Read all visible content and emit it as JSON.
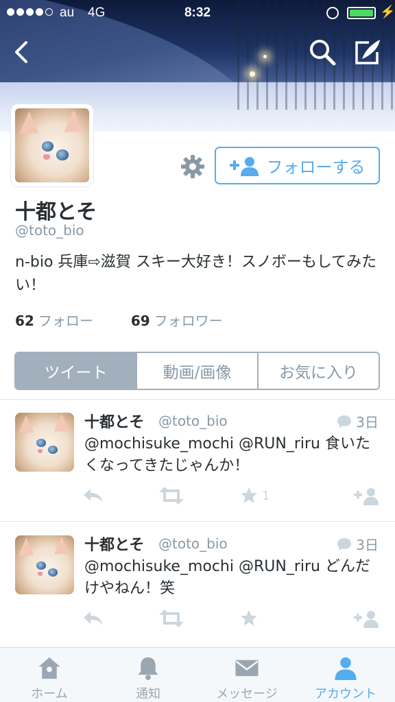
{
  "status_bar": {
    "carrier": "au",
    "network": "4G",
    "time": "8:32"
  },
  "profile": {
    "display_name": "十都とそ",
    "handle": "@toto_bio",
    "bio": "n-bio 兵庫⇨滋賀 スキー大好き！スノボーもしてみたい！",
    "following_count": "62",
    "following_label": "フォロー",
    "followers_count": "69",
    "followers_label": "フォロワー",
    "follow_button_label": "フォローする"
  },
  "segments": [
    {
      "label": "ツイート",
      "active": true
    },
    {
      "label": "動画/画像",
      "active": false
    },
    {
      "label": "お気に入り",
      "active": false
    }
  ],
  "tweets": [
    {
      "name": "十都とそ",
      "handle": "@toto_bio",
      "time": "3日",
      "text": "@mochisuke_mochi @RUN_riru 食いたくなってきたじゃんか！",
      "favorite_count": "1"
    },
    {
      "name": "十都とそ",
      "handle": "@toto_bio",
      "time": "3日",
      "text": "@mochisuke_mochi @RUN_riru どんだけやねん！笑",
      "favorite_count": ""
    }
  ],
  "tabbar": [
    {
      "label": "ホーム",
      "icon": "home-icon",
      "active": false
    },
    {
      "label": "通知",
      "icon": "bell-icon",
      "active": false
    },
    {
      "label": "メッセージ",
      "icon": "envelope-icon",
      "active": false
    },
    {
      "label": "アカウント",
      "icon": "person-icon",
      "active": true
    }
  ],
  "colors": {
    "accent": "#55acee",
    "muted": "#8899a6",
    "segment_active_bg": "#a2b0bd"
  }
}
